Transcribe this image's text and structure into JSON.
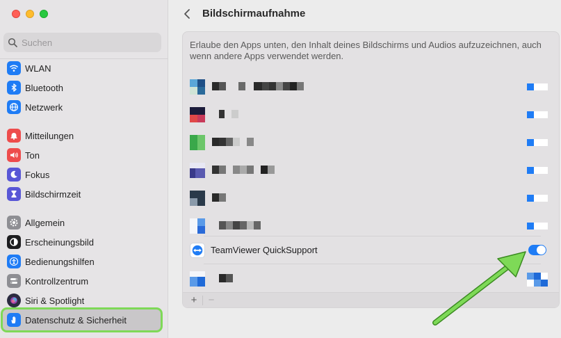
{
  "window": {
    "title": "Bildschirmaufnahme"
  },
  "search": {
    "placeholder": "Suchen"
  },
  "sidebar": {
    "items": [
      {
        "label": "WLAN",
        "icon": "wifi-icon",
        "color": "#1f7cf5"
      },
      {
        "label": "Bluetooth",
        "icon": "bluetooth-icon",
        "color": "#1f7cf5"
      },
      {
        "label": "Netzwerk",
        "icon": "globe-icon",
        "color": "#1f7cf5"
      },
      {
        "label": "Mitteilungen",
        "icon": "bell-icon",
        "color": "#ee4c4c"
      },
      {
        "label": "Ton",
        "icon": "speaker-icon",
        "color": "#ee4c4c"
      },
      {
        "label": "Fokus",
        "icon": "moon-icon",
        "color": "#5856d6"
      },
      {
        "label": "Bildschirmzeit",
        "icon": "hourglass-icon",
        "color": "#5856d6"
      },
      {
        "label": "Allgemein",
        "icon": "gear-icon",
        "color": "#8e8e93"
      },
      {
        "label": "Erscheinungsbild",
        "icon": "appearance-icon",
        "color": "#1d1d1f"
      },
      {
        "label": "Bedienungshilfen",
        "icon": "accessibility-icon",
        "color": "#1f7cf5"
      },
      {
        "label": "Kontrollzentrum",
        "icon": "switches-icon",
        "color": "#8e8e93"
      },
      {
        "label": "Siri & Spotlight",
        "icon": "siri-icon",
        "color": "#2b2b40"
      },
      {
        "label": "Datenschutz & Sicherheit",
        "icon": "hand-icon",
        "color": "#1f7cf5",
        "selected": true
      }
    ]
  },
  "main": {
    "description": "Erlaube den Apps unten, den Inhalt deines Bildschirms und Audios aufzuzeichnen, auch wenn andere Apps verwendet werden.",
    "apps": [
      {
        "name": "TeamViewer QuickSupport",
        "enabled": true,
        "icon": "teamviewer-icon"
      }
    ],
    "add_label": "+",
    "remove_label": "−"
  },
  "colors": {
    "accent": "#1f7cf5",
    "highlight": "#7ed957"
  }
}
